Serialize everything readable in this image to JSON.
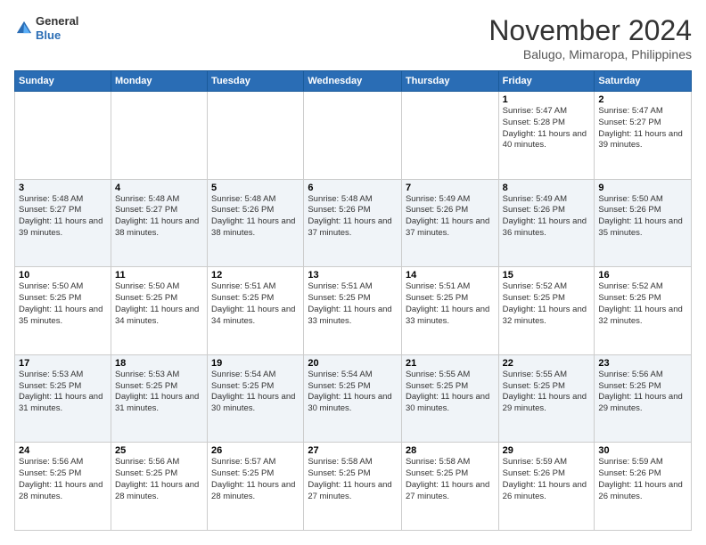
{
  "header": {
    "logo_line1": "General",
    "logo_line2": "Blue",
    "month": "November 2024",
    "location": "Balugo, Mimaropa, Philippines"
  },
  "days_of_week": [
    "Sunday",
    "Monday",
    "Tuesday",
    "Wednesday",
    "Thursday",
    "Friday",
    "Saturday"
  ],
  "weeks": [
    [
      {
        "day": "",
        "sunrise": "",
        "sunset": "",
        "daylight": ""
      },
      {
        "day": "",
        "sunrise": "",
        "sunset": "",
        "daylight": ""
      },
      {
        "day": "",
        "sunrise": "",
        "sunset": "",
        "daylight": ""
      },
      {
        "day": "",
        "sunrise": "",
        "sunset": "",
        "daylight": ""
      },
      {
        "day": "",
        "sunrise": "",
        "sunset": "",
        "daylight": ""
      },
      {
        "day": "1",
        "sunrise": "5:47 AM",
        "sunset": "5:28 PM",
        "daylight": "11 hours and 40 minutes."
      },
      {
        "day": "2",
        "sunrise": "5:47 AM",
        "sunset": "5:27 PM",
        "daylight": "11 hours and 39 minutes."
      }
    ],
    [
      {
        "day": "3",
        "sunrise": "5:48 AM",
        "sunset": "5:27 PM",
        "daylight": "11 hours and 39 minutes."
      },
      {
        "day": "4",
        "sunrise": "5:48 AM",
        "sunset": "5:27 PM",
        "daylight": "11 hours and 38 minutes."
      },
      {
        "day": "5",
        "sunrise": "5:48 AM",
        "sunset": "5:26 PM",
        "daylight": "11 hours and 38 minutes."
      },
      {
        "day": "6",
        "sunrise": "5:48 AM",
        "sunset": "5:26 PM",
        "daylight": "11 hours and 37 minutes."
      },
      {
        "day": "7",
        "sunrise": "5:49 AM",
        "sunset": "5:26 PM",
        "daylight": "11 hours and 37 minutes."
      },
      {
        "day": "8",
        "sunrise": "5:49 AM",
        "sunset": "5:26 PM",
        "daylight": "11 hours and 36 minutes."
      },
      {
        "day": "9",
        "sunrise": "5:50 AM",
        "sunset": "5:26 PM",
        "daylight": "11 hours and 35 minutes."
      }
    ],
    [
      {
        "day": "10",
        "sunrise": "5:50 AM",
        "sunset": "5:25 PM",
        "daylight": "11 hours and 35 minutes."
      },
      {
        "day": "11",
        "sunrise": "5:50 AM",
        "sunset": "5:25 PM",
        "daylight": "11 hours and 34 minutes."
      },
      {
        "day": "12",
        "sunrise": "5:51 AM",
        "sunset": "5:25 PM",
        "daylight": "11 hours and 34 minutes."
      },
      {
        "day": "13",
        "sunrise": "5:51 AM",
        "sunset": "5:25 PM",
        "daylight": "11 hours and 33 minutes."
      },
      {
        "day": "14",
        "sunrise": "5:51 AM",
        "sunset": "5:25 PM",
        "daylight": "11 hours and 33 minutes."
      },
      {
        "day": "15",
        "sunrise": "5:52 AM",
        "sunset": "5:25 PM",
        "daylight": "11 hours and 32 minutes."
      },
      {
        "day": "16",
        "sunrise": "5:52 AM",
        "sunset": "5:25 PM",
        "daylight": "11 hours and 32 minutes."
      }
    ],
    [
      {
        "day": "17",
        "sunrise": "5:53 AM",
        "sunset": "5:25 PM",
        "daylight": "11 hours and 31 minutes."
      },
      {
        "day": "18",
        "sunrise": "5:53 AM",
        "sunset": "5:25 PM",
        "daylight": "11 hours and 31 minutes."
      },
      {
        "day": "19",
        "sunrise": "5:54 AM",
        "sunset": "5:25 PM",
        "daylight": "11 hours and 30 minutes."
      },
      {
        "day": "20",
        "sunrise": "5:54 AM",
        "sunset": "5:25 PM",
        "daylight": "11 hours and 30 minutes."
      },
      {
        "day": "21",
        "sunrise": "5:55 AM",
        "sunset": "5:25 PM",
        "daylight": "11 hours and 30 minutes."
      },
      {
        "day": "22",
        "sunrise": "5:55 AM",
        "sunset": "5:25 PM",
        "daylight": "11 hours and 29 minutes."
      },
      {
        "day": "23",
        "sunrise": "5:56 AM",
        "sunset": "5:25 PM",
        "daylight": "11 hours and 29 minutes."
      }
    ],
    [
      {
        "day": "24",
        "sunrise": "5:56 AM",
        "sunset": "5:25 PM",
        "daylight": "11 hours and 28 minutes."
      },
      {
        "day": "25",
        "sunrise": "5:56 AM",
        "sunset": "5:25 PM",
        "daylight": "11 hours and 28 minutes."
      },
      {
        "day": "26",
        "sunrise": "5:57 AM",
        "sunset": "5:25 PM",
        "daylight": "11 hours and 28 minutes."
      },
      {
        "day": "27",
        "sunrise": "5:58 AM",
        "sunset": "5:25 PM",
        "daylight": "11 hours and 27 minutes."
      },
      {
        "day": "28",
        "sunrise": "5:58 AM",
        "sunset": "5:25 PM",
        "daylight": "11 hours and 27 minutes."
      },
      {
        "day": "29",
        "sunrise": "5:59 AM",
        "sunset": "5:26 PM",
        "daylight": "11 hours and 26 minutes."
      },
      {
        "day": "30",
        "sunrise": "5:59 AM",
        "sunset": "5:26 PM",
        "daylight": "11 hours and 26 minutes."
      }
    ]
  ]
}
